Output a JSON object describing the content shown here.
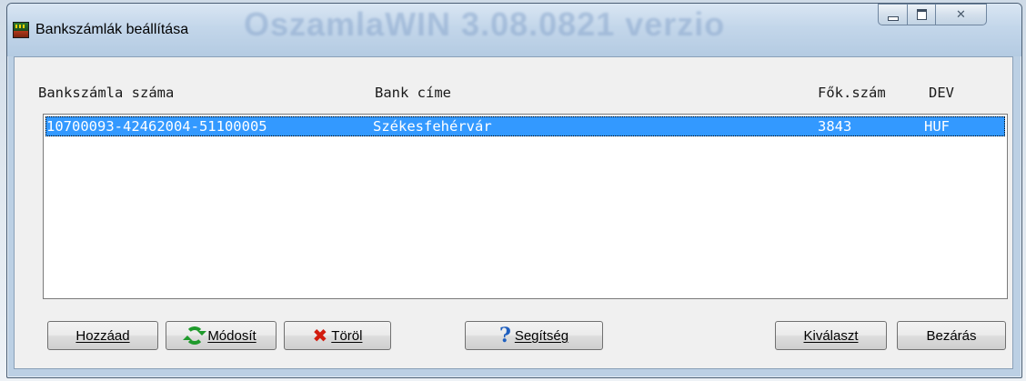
{
  "window": {
    "title": "Bankszámlák beállítása",
    "background_title": "OszamlaWIN 3.08.0821 verzio",
    "caption_close": "✕"
  },
  "list": {
    "headers": {
      "account_number": "Bankszámla száma",
      "bank_address": "Bank címe",
      "ledger_number": "Fők.szám",
      "currency": "DEV"
    },
    "rows": [
      {
        "account_number": "10700093-42462004-51100005",
        "bank_address": "Székesfehérvár",
        "ledger_number": "3843",
        "currency": "HUF",
        "selected": true
      }
    ]
  },
  "buttons": {
    "add": "Hozzáad",
    "modify": "Módosít",
    "delete": "Töröl",
    "help": "Segítség",
    "select": "Kiválaszt",
    "close": "Bezárás"
  },
  "colors": {
    "selection": "#3399ff",
    "modify_icon": "#1f9a2c",
    "delete_icon": "#d21c0f",
    "help_icon": "#1f5fbf"
  },
  "icons": {
    "app": "oszamla-app-icon",
    "modify": "refresh-icon",
    "delete": "red-x-icon",
    "help": "question-mark-icon"
  }
}
